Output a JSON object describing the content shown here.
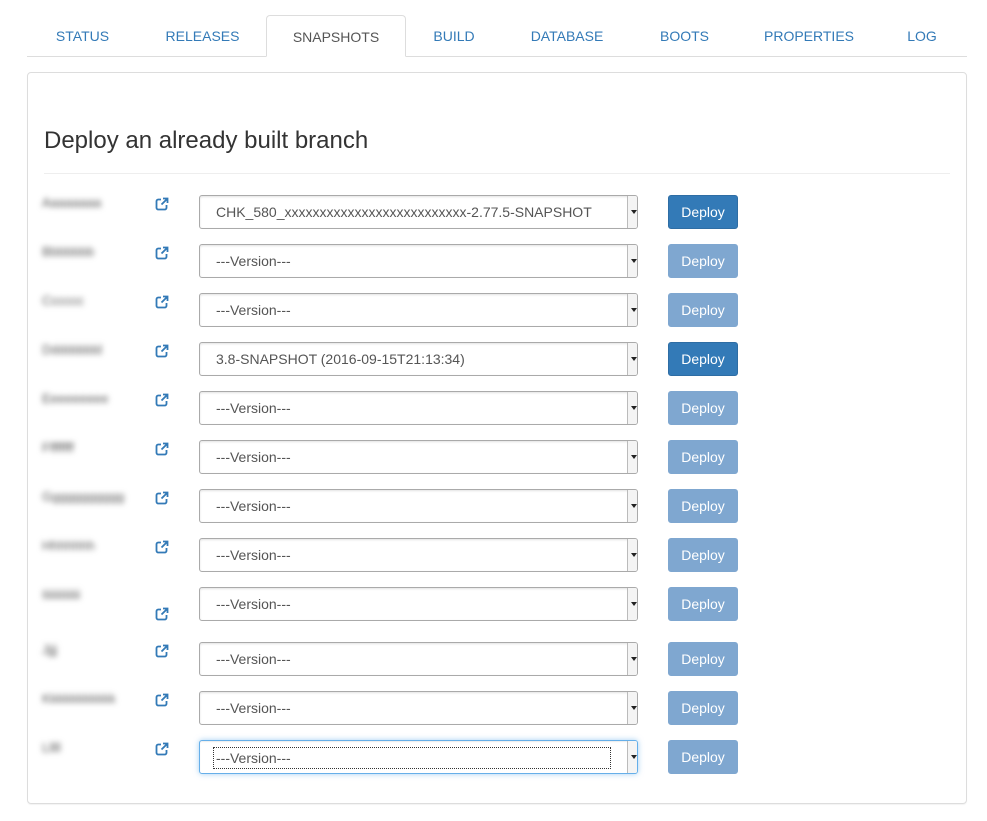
{
  "tabs": [
    {
      "label": "STATUS",
      "active": false
    },
    {
      "label": "RELEASES",
      "active": false
    },
    {
      "label": "SNAPSHOTS",
      "active": true
    },
    {
      "label": "BUILD",
      "active": false
    },
    {
      "label": "DATABASE",
      "active": false
    },
    {
      "label": "BOOTS",
      "active": false
    },
    {
      "label": "PROPERTIES",
      "active": false
    },
    {
      "label": "LOG",
      "active": false
    }
  ],
  "panel": {
    "title": "Deploy an already built branch"
  },
  "rows": [
    {
      "branch": "Aaaaaaaa",
      "version": "CHK_580_xxxxxxxxxxxxxxxxxxxxxxxxxx-2.77.5-SNAPSHOT",
      "deploy_label": "Deploy",
      "deploy_enabled": true
    },
    {
      "branch": "Bbbbbbb",
      "version": "---Version---",
      "deploy_label": "Deploy",
      "deploy_enabled": false
    },
    {
      "branch": "Cccccc",
      "version": "---Version---",
      "deploy_label": "Deploy",
      "deploy_enabled": false
    },
    {
      "branch": "Dddddddd",
      "version": "3.8-SNAPSHOT (2016-09-15T21:13:34)",
      "deploy_label": "Deploy",
      "deploy_enabled": true
    },
    {
      "branch": "Eeeeeeeee",
      "version": "---Version---",
      "deploy_label": "Deploy",
      "deploy_enabled": false
    },
    {
      "branch": "Ffffffff",
      "version": "---Version---",
      "deploy_label": "Deploy",
      "deploy_enabled": false
    },
    {
      "branch": "Ggggggggggg",
      "version": "---Version---",
      "deploy_label": "Deploy",
      "deploy_enabled": false
    },
    {
      "branch": "Hhhhhhh",
      "version": "---Version---",
      "deploy_label": "Deploy",
      "deploy_enabled": false
    },
    {
      "branch": "Iiiiiiiiiiiii",
      "version": "---Version---",
      "deploy_label": "Deploy",
      "deploy_enabled": false
    },
    {
      "branch": "Jjjj",
      "version": "---Version---",
      "deploy_label": "Deploy",
      "deploy_enabled": false
    },
    {
      "branch": "Kkkkkkkkkkk",
      "version": "---Version---",
      "deploy_label": "Deploy",
      "deploy_enabled": false
    },
    {
      "branch": "Lllll",
      "version": "---Version---",
      "deploy_label": "Deploy",
      "deploy_enabled": false,
      "focused": true
    }
  ],
  "colors": {
    "link": "#337ab7",
    "primary": "#337ab7",
    "primary_disabled": "#7fa7d0"
  },
  "icons": {
    "external_link": "external-link-icon",
    "select_caret": "chevron-down-icon"
  }
}
